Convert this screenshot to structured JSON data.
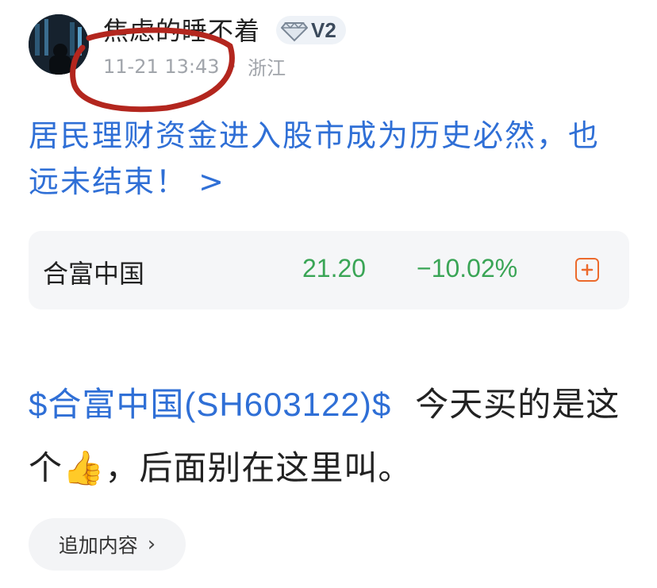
{
  "header": {
    "username": "焦虑的睡不着",
    "badge": {
      "icon": "diamond-icon",
      "label": "V2"
    },
    "timestamp": "11-21 13:43",
    "separator": "·",
    "location": "浙江"
  },
  "headline": {
    "text": "居民理财资金进入股市成为历史必然，也远未结束！",
    "arrow": ">"
  },
  "stock_card": {
    "name": "合富中国",
    "price": "21.20",
    "change": "−10.02%",
    "add_icon": "plus-square-icon",
    "colors": {
      "price": "#3aa556",
      "add": "#ec6a2c"
    }
  },
  "post": {
    "stock_tag": "$合富中国(SH603122)$",
    "text_before_emoji": "今天买的是这个",
    "emoji": "👍",
    "text_after_emoji": "，后面别在这里叫。"
  },
  "append_button": {
    "label": "追加内容",
    "chevron": "›"
  },
  "colors": {
    "link": "#2f6fd6",
    "annotation": "#b3261e"
  }
}
